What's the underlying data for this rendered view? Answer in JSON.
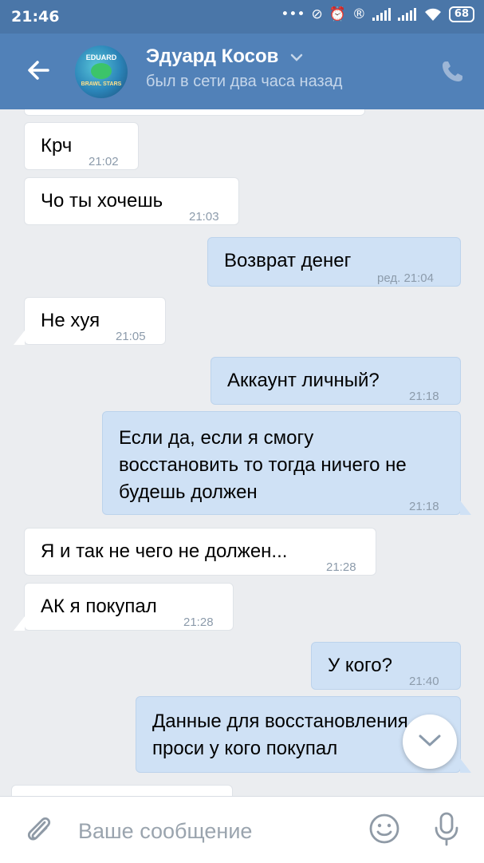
{
  "statusbar": {
    "time": "21:46",
    "battery": "68",
    "icons": [
      "more-dots",
      "alarm-off",
      "alarm",
      "registered",
      "signal",
      "signal",
      "wifi",
      "battery"
    ]
  },
  "header": {
    "name": "Эдуард Косов",
    "status": "был в сети два часа назад",
    "avatar_top": "EDUARD",
    "avatar_bottom": "BRAWL STARS"
  },
  "messages": [
    {
      "dir": "in",
      "text": "Крч",
      "time": "21:02"
    },
    {
      "dir": "in",
      "text": "Чо ты хочешь",
      "time": "21:03"
    },
    {
      "dir": "out",
      "text": "Возврат денег",
      "time": "ред. 21:04"
    },
    {
      "dir": "in",
      "text": "Не хуя",
      "time": "21:05"
    },
    {
      "dir": "out",
      "text": "Аккаунт личный?",
      "time": "21:18"
    },
    {
      "dir": "out",
      "text": "Если да, если я смогу\nвосстановить то тогда ничего не\nбудешь должен",
      "time": "21:18"
    },
    {
      "dir": "in",
      "text": "Я и так не чего не должен...",
      "time": "21:28"
    },
    {
      "dir": "in",
      "text": "АК я покупал",
      "time": "21:28"
    },
    {
      "dir": "out",
      "text": "У кого?",
      "time": "21:40"
    },
    {
      "dir": "out",
      "text": "Данные для восстановления\nпроси у кого покупал",
      "time": ""
    }
  ],
  "composer": {
    "placeholder": "Ваше сообщение"
  },
  "colors": {
    "header": "#5181b8",
    "statusbar": "#4a76a8",
    "chat_bg": "#ebedf0",
    "incoming": "#ffffff",
    "outgoing": "#cfe1f5"
  }
}
